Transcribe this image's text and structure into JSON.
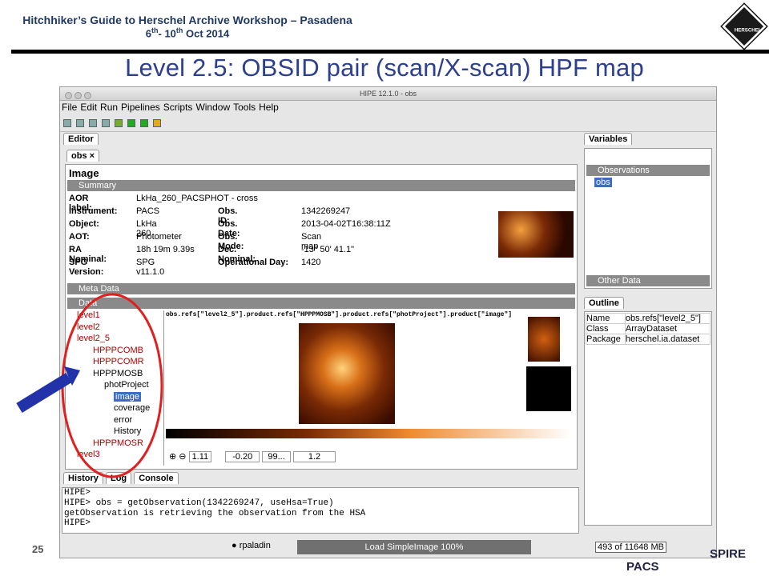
{
  "slide": {
    "header_line1": "Hitchhiker’s Guide to Herschel Archive Workshop – Pasadena",
    "header_line2_a": "6",
    "header_line2_b": "th",
    "header_line2_c": "- 10",
    "header_line2_d": "th",
    "header_line2_e": " Oct 2014",
    "title": "Level 2.5: OBSID pair (scan/X-scan) HPF map",
    "page_number": "25",
    "logo_text": "HERSCHEL",
    "footer_logo": "SPIRE",
    "footer_logo2": "PACS"
  },
  "window": {
    "title": "HIPE 12.1.0 - obs",
    "menu": [
      "File",
      "Edit",
      "Run",
      "Pipelines",
      "Scripts",
      "Window",
      "Tools",
      "Help"
    ]
  },
  "editor": {
    "tab": "Editor",
    "doc_tab": "obs",
    "heading": "Image",
    "summary": "Summary",
    "meta": "Meta Data",
    "data": "Data",
    "fields": {
      "aor_l": "AOR label:",
      "aor_v": "LkHa_260_PACSPHOT - cross",
      "inst_l": "Instrument:",
      "inst_v": "PACS",
      "obsid_l": "Obs. ID:",
      "obsid_v": "1342269247",
      "obj_l": "Object:",
      "obj_v": "LkHa 260",
      "date_l": "Obs. Date:",
      "date_v": "2013-04-02T16:38:11Z",
      "aot_l": "AOT:",
      "aot_v": "Photometer",
      "mode_l": "Obs. Mode:",
      "mode_v": "Scan map",
      "ra_l": "RA Nominal:",
      "ra_v": "18h 19m 9.39s",
      "dec_l": "Dec. Nominal:",
      "dec_v": "-13° 50' 41.1\"",
      "spg_l": "SPG Version:",
      "spg_v": "SPG v11.1.0",
      "od_l": "Operational Day:",
      "od_v": "1420"
    },
    "tree": [
      "level1",
      "level2",
      "level2_5",
      "HPPPCOMB",
      "HPPPCOMR",
      "HPPPMOSB",
      "photProject",
      "image",
      "coverage",
      "error",
      "History",
      "HPPPMOSR",
      "level3"
    ],
    "image_path": "obs.refs[\"level2_5\"].product.refs[\"HPPPMOSB\"].product.refs[\"photProject\"].product[\"image\"]",
    "controls": {
      "zoom": "1.11",
      "min": "-0.20",
      "pct": "99...",
      "max": "1.2"
    }
  },
  "variables": {
    "tab": "Variables",
    "obs_section": "Observations",
    "item": "obs",
    "other": "Other Data"
  },
  "outline": {
    "tab": "Outline",
    "rows": [
      [
        "Name",
        "obs.refs[\"level2_5\"]"
      ],
      [
        "Class",
        "ArrayDataset"
      ],
      [
        "Package",
        "herschel.ia.dataset"
      ]
    ]
  },
  "console": {
    "tabs": [
      "History",
      "Log",
      "Console"
    ],
    "lines": [
      "HIPE>",
      "HIPE> obs = getObservation(1342269247, useHsa=True)",
      "getObservation is retrieving the observation from the HSA",
      "HIPE>"
    ]
  },
  "status": {
    "user": "rpaladin",
    "task": "Load SimpleImage 100%",
    "mem": "493 of 11648 MB"
  }
}
